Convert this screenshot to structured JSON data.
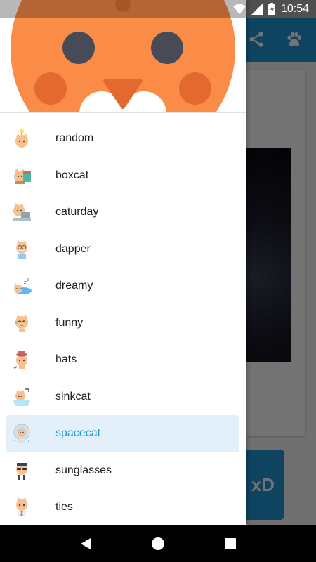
{
  "status_bar": {
    "time": "10:54"
  },
  "background": {
    "xd_label": "xD"
  },
  "drawer": {
    "items": [
      {
        "label": "random",
        "icon": "cat-lightbulb-icon",
        "selected": false
      },
      {
        "label": "boxcat",
        "icon": "cat-box-icon",
        "selected": false
      },
      {
        "label": "caturday",
        "icon": "cat-laptop-icon",
        "selected": false
      },
      {
        "label": "dapper",
        "icon": "cat-dapper-icon",
        "selected": false
      },
      {
        "label": "dreamy",
        "icon": "cat-sleeping-icon",
        "selected": false
      },
      {
        "label": "funny",
        "icon": "cat-funny-icon",
        "selected": false
      },
      {
        "label": "hats",
        "icon": "cat-hat-icon",
        "selected": false
      },
      {
        "label": "sinkcat",
        "icon": "cat-sink-icon",
        "selected": false
      },
      {
        "label": "spacecat",
        "icon": "cat-astronaut-icon",
        "selected": true
      },
      {
        "label": "sunglasses",
        "icon": "cat-sunglasses-icon",
        "selected": false
      },
      {
        "label": "ties",
        "icon": "cat-tie-icon",
        "selected": false
      }
    ]
  },
  "colors": {
    "accent": "#1f97d4",
    "selected_bg": "#e3f0fa",
    "cat_orange": "#fb8c48"
  }
}
